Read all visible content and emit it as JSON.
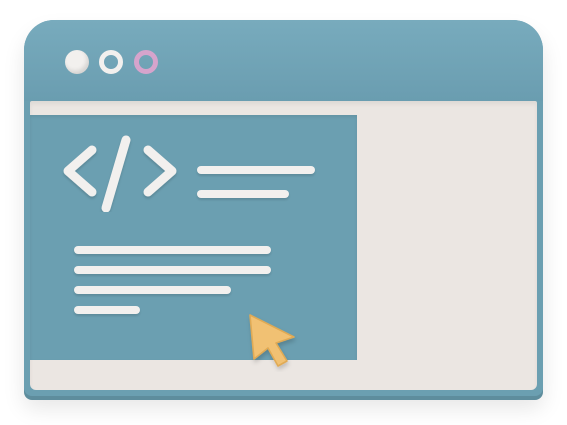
{
  "window": {
    "buttons": [
      {
        "name": "window-dot-1",
        "color": "#f2f0ee",
        "style": "filled"
      },
      {
        "name": "window-dot-2",
        "color": "#f2f0ee",
        "style": "ring"
      },
      {
        "name": "window-dot-3",
        "color": "#d6a4cc",
        "style": "ring"
      }
    ]
  },
  "icons": {
    "code": "code-brackets-icon",
    "cursor": "mouse-cursor-icon"
  },
  "colors": {
    "frame": "#6b9fb1",
    "content_background": "#ebe6e2",
    "text_lines": "#f2f0ee",
    "cursor": "#f1c173",
    "accent_dot": "#d6a4cc"
  }
}
